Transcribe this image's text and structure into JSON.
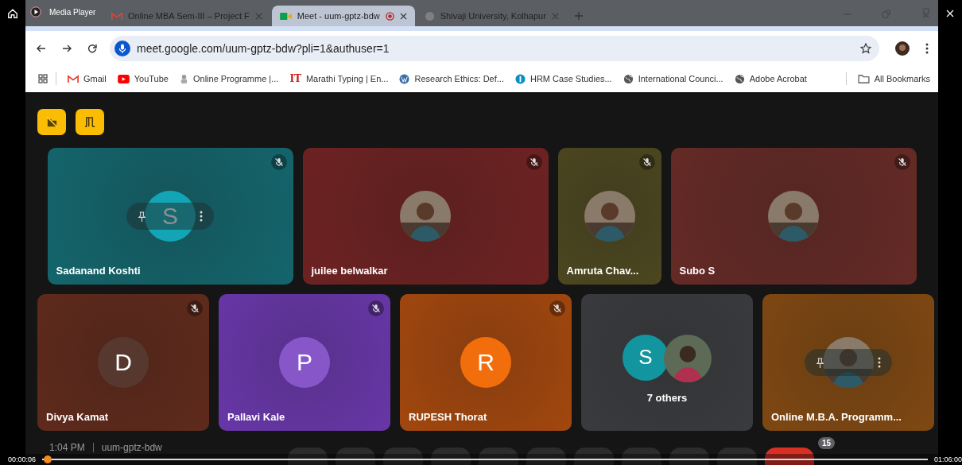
{
  "media_player": {
    "title": "Media Player",
    "elapsed": "00:00:06",
    "total": "01:06:00",
    "level": 0.002
  },
  "tabs": [
    {
      "title": "Online MBA Sem-III – Project F",
      "selected": false,
      "recording": false,
      "kind": "gmail"
    },
    {
      "title": "Meet - uum-gptz-bdw",
      "selected": true,
      "recording": true,
      "kind": "meet"
    },
    {
      "title": "Shivaji University, Kolhapur",
      "selected": false,
      "recording": false,
      "kind": "logo"
    }
  ],
  "address_bar": {
    "url": "meet.google.com/uum-gptz-bdw?pli=1&authuser=1"
  },
  "bookmarks": [
    {
      "label": "Gmail",
      "kind": "gmail"
    },
    {
      "label": "YouTube",
      "kind": "youtube"
    },
    {
      "label": "Online Programme |...",
      "kind": "logo"
    },
    {
      "label": "Marathi Typing | En...",
      "kind": "letters",
      "badge": "IT"
    },
    {
      "label": "Research Ethics: Def...",
      "kind": "wordpress"
    },
    {
      "label": "HRM Case Studies...",
      "kind": "circle"
    },
    {
      "label": "International Counci...",
      "kind": "globe"
    },
    {
      "label": "Adobe Acrobat",
      "kind": "globe"
    }
  ],
  "all_bookmarks": "All Bookmarks",
  "grid": [
    {
      "tiles": [
        {
          "name": "Sadanand Koshti",
          "color": "#14656c",
          "muted": true,
          "hovered": true,
          "avatar": {
            "kind": "letter",
            "letter": "S",
            "color": "#13a5b5"
          }
        },
        {
          "name": "juilee belwalkar",
          "color": "#6e2222",
          "muted": true,
          "hovered": false
        },
        {
          "name": "Amruta Chav...",
          "color": "#4c4720",
          "muted": true,
          "hovered": false
        },
        {
          "name": "Subo S",
          "color": "#652a26",
          "muted": true,
          "hovered": false
        }
      ]
    },
    {
      "tiles": [
        {
          "name": "Divya Kamat",
          "color": "#5f2a1c",
          "muted": true,
          "hovered": false,
          "avatar": {
            "kind": "letter",
            "letter": "D",
            "color": "#57382f"
          }
        },
        {
          "name": "Pallavi Kale",
          "color": "#6837a8",
          "muted": true,
          "hovered": false,
          "avatar": {
            "kind": "letter",
            "letter": "P",
            "color": "#8757c9"
          }
        },
        {
          "name": "RUPESH Thorat",
          "color": "#a3470e",
          "muted": true,
          "hovered": false,
          "avatar": {
            "kind": "letter",
            "letter": "R",
            "color": "#f26e0c"
          }
        },
        {
          "color": "#3a3b3e",
          "muted": false,
          "hovered": false,
          "avatar": {
            "kind": "others",
            "letter": "S",
            "color": "#12959f",
            "caption": "7 others"
          }
        },
        {
          "name": "Online M.B.A. Programm...",
          "color": "#7f4812",
          "muted": false,
          "hovered": true
        }
      ]
    }
  ],
  "footer": {
    "time": "1:04 PM",
    "meeting_code": "uum-gptz-bdw",
    "people_count": "15"
  }
}
